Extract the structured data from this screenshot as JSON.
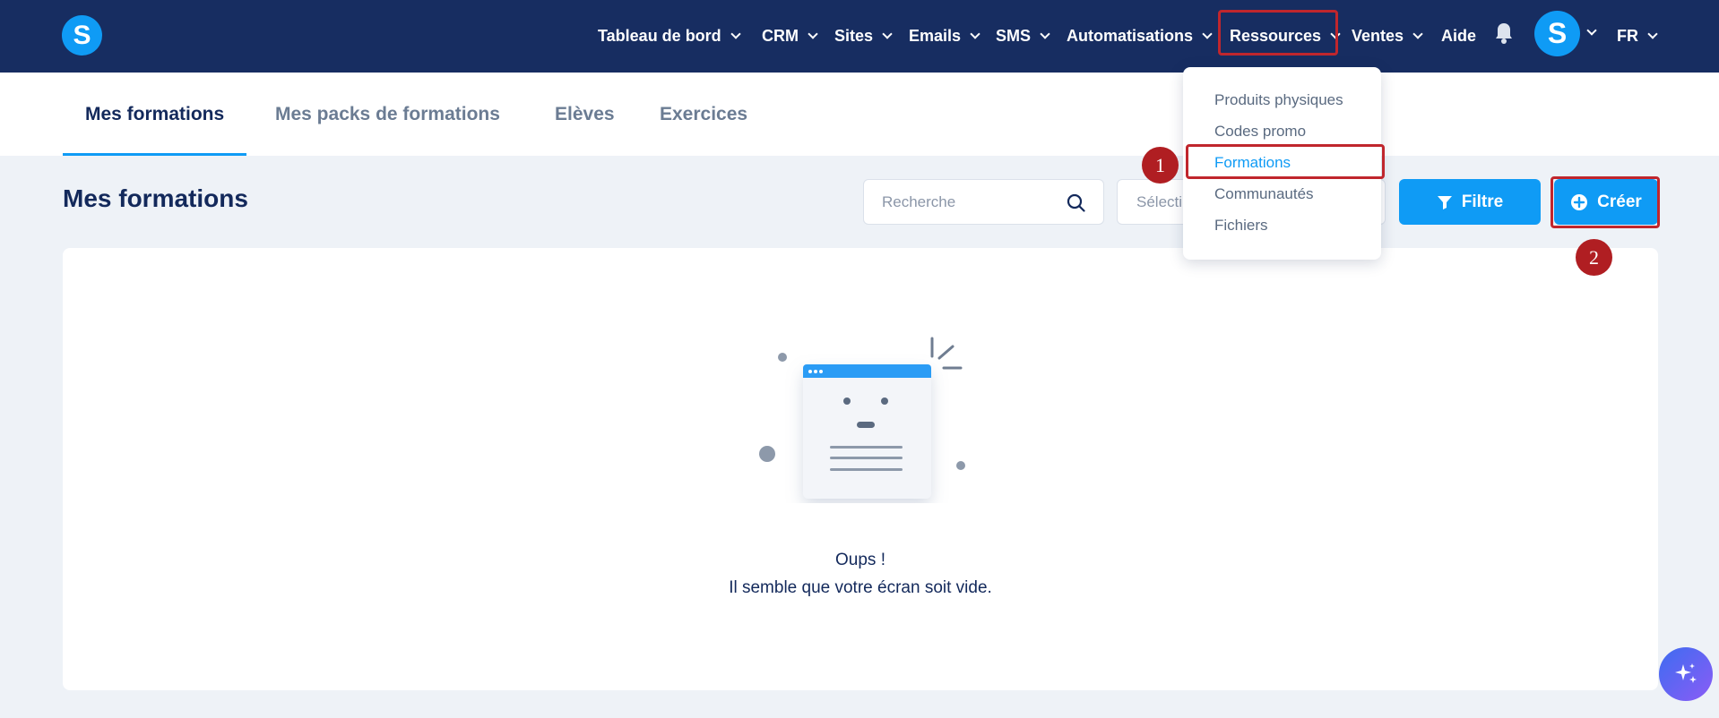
{
  "topnav": {
    "logo_letter": "S",
    "items": [
      {
        "label": "Tableau de bord"
      },
      {
        "label": "CRM"
      },
      {
        "label": "Sites"
      },
      {
        "label": "Emails"
      },
      {
        "label": "SMS"
      },
      {
        "label": "Automatisations"
      },
      {
        "label": "Ressources"
      },
      {
        "label": "Ventes"
      },
      {
        "label": "Aide"
      }
    ],
    "avatar_letter": "S",
    "language": "FR"
  },
  "tabs": [
    {
      "label": "Mes formations",
      "active": true
    },
    {
      "label": "Mes packs de formations",
      "active": false
    },
    {
      "label": "Elèves",
      "active": false
    },
    {
      "label": "Exercices",
      "active": false
    }
  ],
  "page": {
    "title": "Mes formations",
    "search_placeholder": "Recherche",
    "select_placeholder": "Sélecti",
    "filter_label": "Filtre",
    "create_label": "Créer"
  },
  "dropdown": {
    "items": [
      {
        "label": "Produits physiques"
      },
      {
        "label": "Codes promo"
      },
      {
        "label": "Formations",
        "active": true
      },
      {
        "label": "Communautés"
      },
      {
        "label": "Fichiers"
      }
    ]
  },
  "annotations": {
    "badge_1": "1",
    "badge_2": "2"
  },
  "empty_state": {
    "line1": "Oups !",
    "line2": "Il semble que votre écran soit vide."
  },
  "colors": {
    "nav_bg": "#172d61",
    "accent": "#0f9bf5",
    "highlight": "#c0262d",
    "badge": "#b01e22"
  }
}
